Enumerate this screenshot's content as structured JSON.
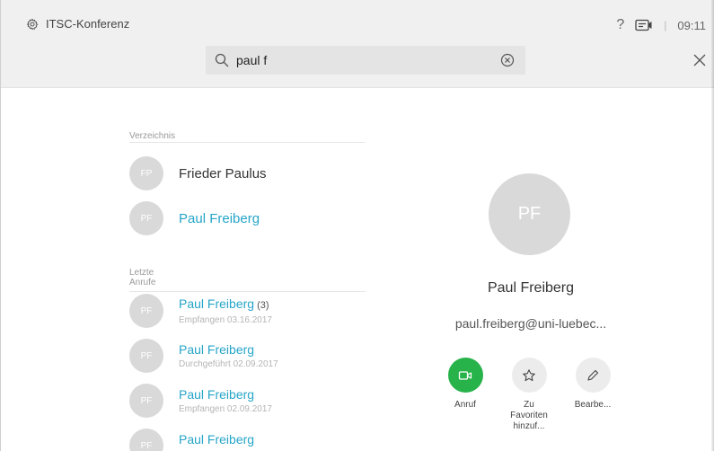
{
  "topbar": {
    "title": "ITSC-Konferenz",
    "help": "?",
    "separator": "|",
    "time": "09:11"
  },
  "search": {
    "value": "paul f",
    "placeholder": ""
  },
  "directory": {
    "label": "Verzeichnis",
    "items": [
      {
        "initials": "FP",
        "name": "Frieder Paulus"
      },
      {
        "initials": "PF",
        "name": "Paul Freiberg"
      }
    ]
  },
  "recent": {
    "label_line1": "Letzte",
    "label_line2": "Anrufe",
    "items": [
      {
        "initials": "PF",
        "name_a": "Paul ",
        "name_b": "F",
        "name_c": "reiberg",
        "count": " (3)",
        "sub": "Empfangen 03.16.2017"
      },
      {
        "initials": "PF",
        "name_a": "Paul ",
        "name_b": "F",
        "name_c": "reiberg",
        "count": "",
        "sub": "Durchgeführt 02.09.2017"
      },
      {
        "initials": "PF",
        "name_a": "Paul ",
        "name_b": "F",
        "name_c": "reiberg",
        "count": "",
        "sub": "Empfangen 02.09.2017"
      },
      {
        "initials": "PF",
        "name_a": "Paul ",
        "name_b": "F",
        "name_c": "reiberg",
        "count": "",
        "sub": ""
      }
    ]
  },
  "detail": {
    "initials": "PF",
    "name": "Paul Freiberg",
    "email": "paul.freiberg@uni-luebec...",
    "actions": [
      {
        "label": "Anruf",
        "icon": "video-camera-icon"
      },
      {
        "label": "Zu Favoriten hinzuf...",
        "icon": "star-icon"
      },
      {
        "label": "Bearbe...",
        "icon": "pencil-icon"
      }
    ]
  },
  "colors": {
    "accent": "#26a5c8",
    "call_green": "#27b24a",
    "avatar_grey": "#d9d9d9",
    "header_bg": "#f0f0f0"
  }
}
